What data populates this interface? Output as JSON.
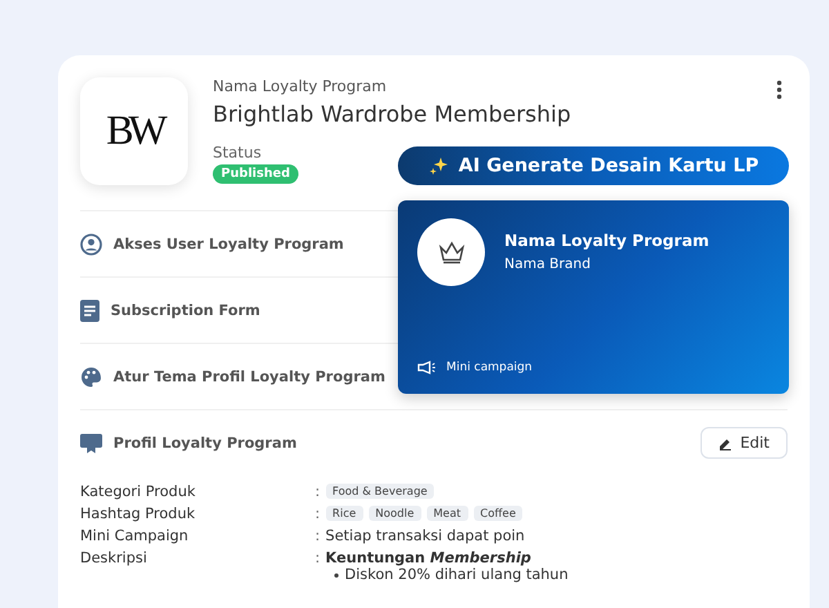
{
  "program": {
    "caption": "Nama Loyalty Program",
    "name": "Brightlab Wardrobe Membership",
    "logo": "BW",
    "status_label": "Status",
    "status": {
      "text": "Published",
      "kind": "published"
    }
  },
  "menu": [
    {
      "label": "Akses User Loyalty Program",
      "kind": "access"
    },
    {
      "label": "Subscription Form",
      "kind": "form"
    },
    {
      "label": "Atur Tema Profil Loyalty Program",
      "kind": "theme"
    },
    {
      "label": "Profil Loyalty Program",
      "kind": "profile",
      "action": "Edit"
    }
  ],
  "details": [
    {
      "label": "Kategori Produk",
      "separator": ":",
      "kind": "tags",
      "tags": [
        "Food & Beverage"
      ]
    },
    {
      "label": "Hashtag Produk",
      "separator": ":",
      "kind": "tags",
      "tags": [
        "Rice",
        "Noodle",
        "Meat",
        "Coffee"
      ]
    },
    {
      "label": "Mini Campaign",
      "separator": ":",
      "kind": "text",
      "value": "Setiap transaksi dapat poin"
    },
    {
      "label": "Deskripsi",
      "separator": ":",
      "kind": "rich",
      "value": "Keuntungan *Membership*",
      "bullets": [
        "Diskon 20% dihari ulang tahun"
      ]
    }
  ],
  "ai_button": {
    "label": "AI Generate Desain Kartu LP"
  },
  "card_preview": {
    "title": "Nama Loyalty Program",
    "brand": "Nama Brand",
    "campaign": "Mini campaign"
  }
}
